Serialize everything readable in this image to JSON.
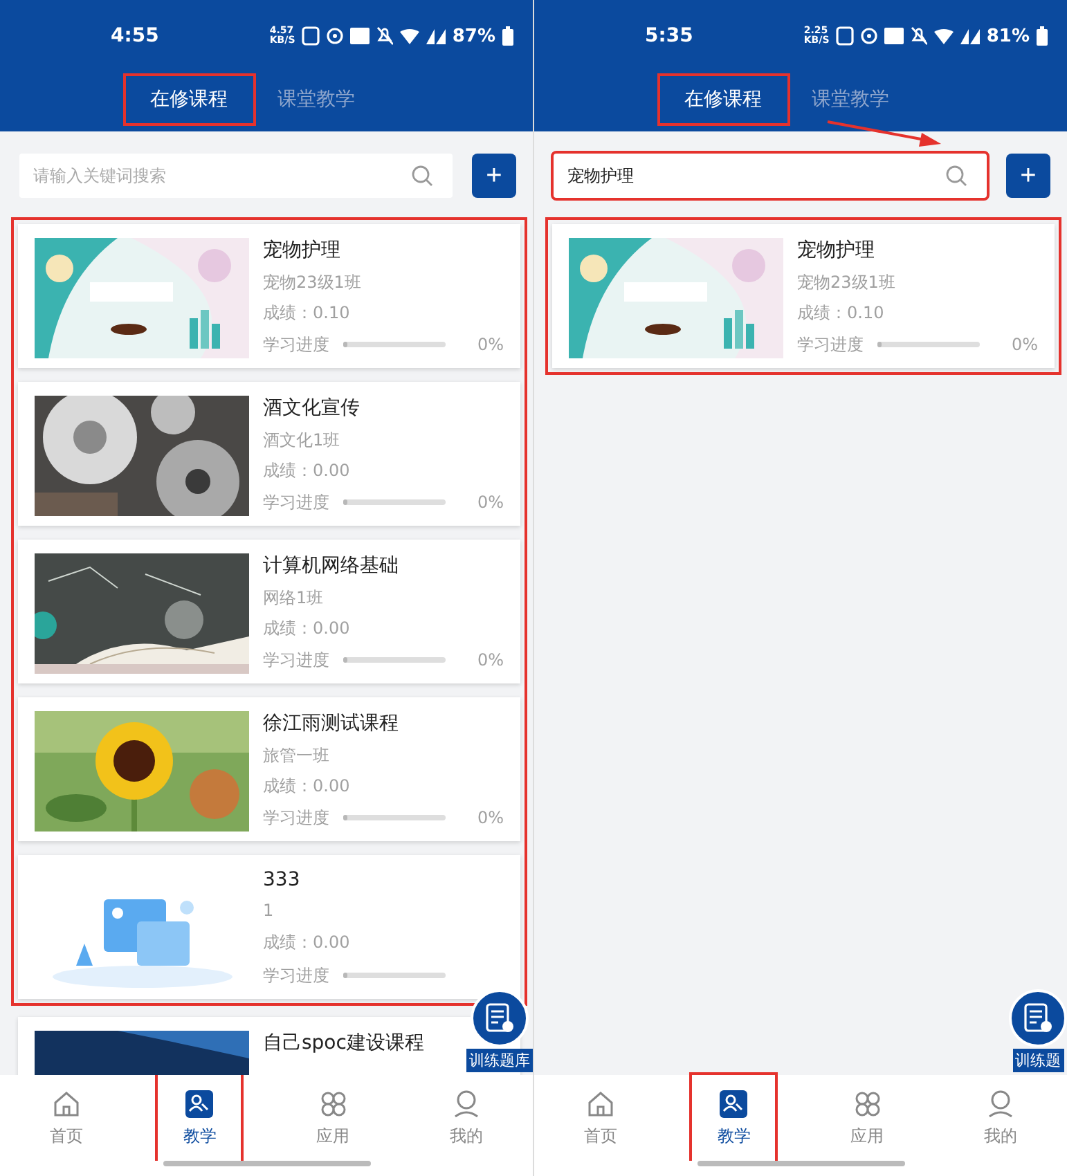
{
  "phones": [
    {
      "status_bar": {
        "time": "4:55",
        "net_speed": "4.57 KB/S",
        "battery": "87%"
      },
      "tabs": [
        {
          "label": "在修课程",
          "selected": true,
          "highlighted": true
        },
        {
          "label": "课堂教学",
          "selected": false,
          "highlighted": false
        }
      ],
      "search": {
        "placeholder": "请输入关键词搜索",
        "highlighted": false
      },
      "add_button": "+",
      "course_list": {
        "highlighted": true,
        "courses": [
          {
            "title": "宠物护理",
            "class": "宠物23级1班",
            "score": "成绩：0.10",
            "progress_label": "学习进度",
            "level": 0,
            "percent": "0%"
          },
          {
            "title": "酒文化宣传",
            "class": "酒文化1班",
            "score": "成绩：0.00",
            "progress_label": "学习进度",
            "level": 0,
            "percent": "0%"
          },
          {
            "title": "计算机网络基础",
            "class": "网络1班",
            "score": "成绩：0.00",
            "progress_label": "学习进度",
            "level": 0,
            "percent": "0%"
          },
          {
            "title": "徐江雨测试课程",
            "class": "旅管一班",
            "score": "成绩：0.00",
            "progress_label": "学习进度",
            "level": 0,
            "percent": "0%"
          },
          {
            "title": "333",
            "class": "1",
            "score": "成绩：0.00",
            "progress_label": "学习进度",
            "level": 0
          }
        ]
      },
      "next_course": {
        "title": "自己spoc建设课程"
      },
      "floating_button": {
        "label": "训练题库"
      },
      "bottom_nav": [
        {
          "label": "首页",
          "selected": false,
          "highlighted": false
        },
        {
          "label": "教学",
          "selected": true,
          "highlighted": true
        },
        {
          "label": "应用",
          "selected": false,
          "highlighted": false
        },
        {
          "label": "我的",
          "selected": false,
          "highlighted": false
        }
      ]
    },
    {
      "status_bar": {
        "time": "5:35",
        "net_speed": "2.25 KB/S",
        "battery": "81%"
      },
      "tabs": [
        {
          "label": "在修课程",
          "selected": true,
          "highlighted": true
        },
        {
          "label": "课堂教学",
          "selected": false,
          "highlighted": false
        }
      ],
      "search": {
        "value": "宠物护理",
        "highlighted": true
      },
      "add_button": "+",
      "course_list": {
        "highlighted": true,
        "courses": [
          {
            "title": "宠物护理",
            "class": "宠物23级1班",
            "score": "成绩：0.10",
            "progress_label": "学习进度",
            "level": 0,
            "percent": "0%"
          }
        ]
      },
      "floating_button": {
        "label": "训练题"
      },
      "bottom_nav": [
        {
          "label": "首页",
          "selected": false,
          "highlighted": false
        },
        {
          "label": "教学",
          "selected": true,
          "highlighted": true
        },
        {
          "label": "应用",
          "selected": false,
          "highlighted": false
        },
        {
          "label": "我的",
          "selected": false,
          "highlighted": false
        }
      ],
      "annotation_arrow": true
    }
  ]
}
